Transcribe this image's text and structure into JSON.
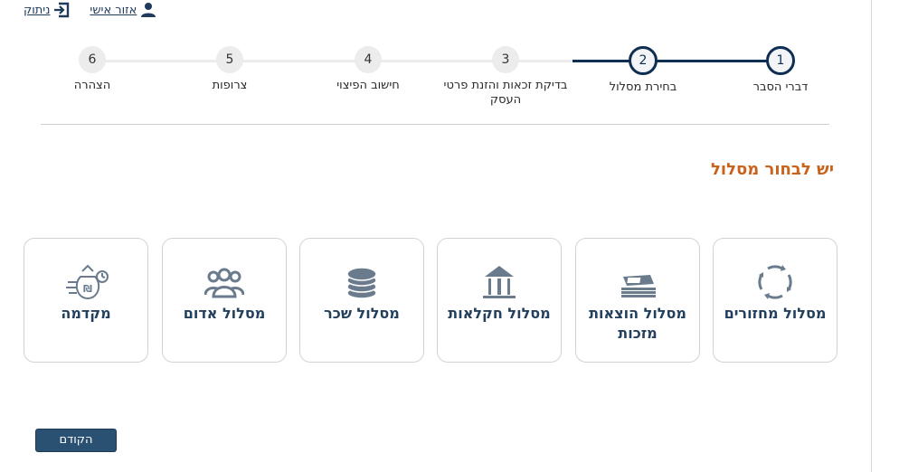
{
  "header": {
    "personal_area_label": "אזור אישי",
    "logout_label": "ניתוק",
    "user_icon": "user-icon",
    "logout_icon": "logout-icon"
  },
  "stepper": {
    "steps": [
      {
        "number": "1",
        "label": "דברי הסבר",
        "state": "active"
      },
      {
        "number": "2",
        "label": "בחירת מסלול",
        "state": "active"
      },
      {
        "number": "3",
        "label": "בדיקת זכאות והזנת פרטי העסק",
        "state": "pending"
      },
      {
        "number": "4",
        "label": "חישוב הפיצוי",
        "state": "pending"
      },
      {
        "number": "5",
        "label": "צרופות",
        "state": "pending"
      },
      {
        "number": "6",
        "label": "הצהרה",
        "state": "pending"
      }
    ]
  },
  "main": {
    "title": "יש לבחור מסלול",
    "tracks": [
      {
        "label": "מסלול מחזורים",
        "icon": "cycle-arrows-icon"
      },
      {
        "label": "מסלול הוצאות מזכות",
        "icon": "money-stack-icon"
      },
      {
        "label": "מסלול חקלאות",
        "icon": "barn-icon"
      },
      {
        "label": "מסלול שכר",
        "icon": "coins-stack-icon"
      },
      {
        "label": "מסלול אדום",
        "icon": "people-group-icon"
      },
      {
        "label": "מקדמה",
        "icon": "fast-money-bag-icon"
      }
    ]
  },
  "footer": {
    "prev_label": "הקודם"
  },
  "colors": {
    "navy": "#0f2f52",
    "title_orange": "#c9621a",
    "button_blue": "#2b5172"
  }
}
